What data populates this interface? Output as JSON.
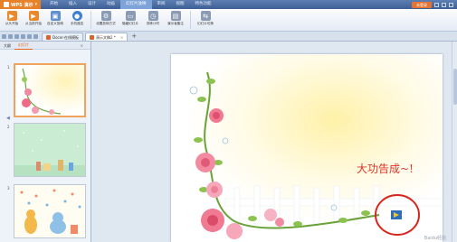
{
  "app": {
    "name": "WPS 演示",
    "login_label": "未登录"
  },
  "menu": [
    "开始",
    "插入",
    "设计",
    "动画",
    "幻灯片放映",
    "审阅",
    "视图",
    "特色功能"
  ],
  "ribbon": [
    {
      "label": "从头开始",
      "icon": "play-icon",
      "color": "#e88a2c"
    },
    {
      "label": "从当前开始",
      "icon": "play-current-icon",
      "color": "#e88a2c"
    },
    {
      "label": "自定义放映",
      "icon": "custom-show-icon",
      "color": "#5e8fcf"
    },
    {
      "label": "手机遥控",
      "icon": "phone-remote-icon",
      "color": "#3f7fd0"
    },
    {
      "label": "设置放映方式",
      "icon": "settings-icon",
      "color": "#8a9bb3"
    },
    {
      "label": "隐藏幻灯片",
      "icon": "hide-slide-icon",
      "color": "#8a9bb3"
    },
    {
      "label": "排练计时",
      "icon": "timer-icon",
      "color": "#8a9bb3"
    },
    {
      "label": "演示者备注",
      "icon": "notes-icon",
      "color": "#8a9bb3"
    },
    {
      "label": "幻灯片切换",
      "icon": "transition-icon",
      "color": "#8a9bb3"
    }
  ],
  "tabs": [
    {
      "label": "Docer-在线模板",
      "active": false
    },
    {
      "label": "演示文稿2 *",
      "active": true
    }
  ],
  "left_panel": {
    "tabs": [
      "大纲",
      "幻灯片"
    ],
    "active_tab": "幻灯片",
    "slide_numbers": [
      "1",
      "2",
      "3"
    ]
  },
  "slide": {
    "text": "大功告成~!"
  },
  "watermark": "Baidu经验"
}
